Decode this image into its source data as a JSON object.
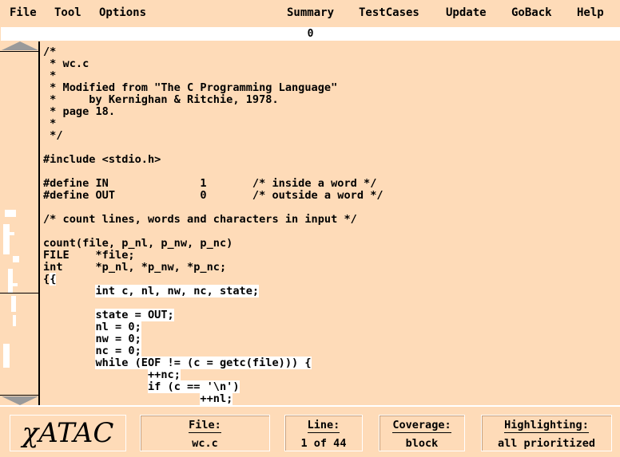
{
  "menu": {
    "file": "File",
    "tool": "Tool",
    "options": "Options",
    "summary": "Summary",
    "testcases": "TestCases",
    "update": "Update",
    "goback": "GoBack",
    "help": "Help"
  },
  "counter": "0",
  "code": [
    {
      "text": "/*",
      "hl": ""
    },
    {
      "text": " * wc.c",
      "hl": ""
    },
    {
      "text": " *",
      "hl": ""
    },
    {
      "text": " * Modified from \"The C Programming Language\"",
      "hl": ""
    },
    {
      "text": " *     by Kernighan & Ritchie, 1978.",
      "hl": ""
    },
    {
      "text": " * page 18.",
      "hl": ""
    },
    {
      "text": " *",
      "hl": ""
    },
    {
      "text": " */",
      "hl": ""
    },
    {
      "text": "",
      "hl": ""
    },
    {
      "text": "#include <stdio.h>",
      "hl": ""
    },
    {
      "text": "",
      "hl": ""
    },
    {
      "text": "#define IN              1       /* inside a word */",
      "hl": ""
    },
    {
      "text": "#define OUT             0       /* outside a word */",
      "hl": ""
    },
    {
      "text": "",
      "hl": ""
    },
    {
      "text": "/* count lines, words and characters in input */",
      "hl": ""
    },
    {
      "text": "",
      "hl": ""
    },
    {
      "text": "count(file, p_nl, p_nw, p_nc)",
      "hl": ""
    },
    {
      "text": "FILE    *file;",
      "hl": ""
    },
    {
      "text": "int     *p_nl, *p_nw, *p_nc;",
      "hl": ""
    },
    {
      "text": "{",
      "hl": "{"
    },
    {
      "text": "        ",
      "hl": "int c, nl, nw, nc, state;"
    },
    {
      "text": "",
      "hl": ""
    },
    {
      "text": "        ",
      "hl": "state = OUT;"
    },
    {
      "text": "        ",
      "hl": "nl = 0;"
    },
    {
      "text": "        ",
      "hl": "nw = 0;"
    },
    {
      "text": "        ",
      "hl": "nc = 0;"
    },
    {
      "text": "        ",
      "hl": "while (EOF != (c = getc(file))) {"
    },
    {
      "text": "                ",
      "hl": "++nc;"
    },
    {
      "text": "                ",
      "hl": "if (c == '\\n')"
    },
    {
      "text": "                        ",
      "hl": "++nl;"
    }
  ],
  "footer": {
    "logo": "χATAC",
    "file_label": "File:",
    "file_value": "wc.c",
    "line_label": "Line:",
    "line_value": "1 of 44",
    "coverage_label": "Coverage:",
    "coverage_value": "block",
    "highlight_label": "Highlighting:",
    "highlight_value": "all prioritized"
  }
}
